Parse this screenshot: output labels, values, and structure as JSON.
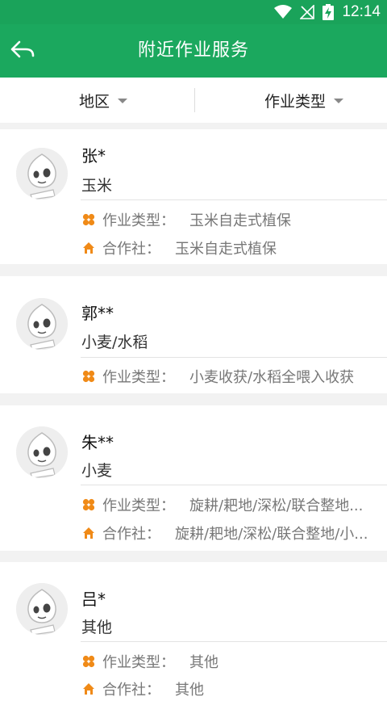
{
  "status": {
    "time": "12:14"
  },
  "appbar": {
    "title": "附近作业服务"
  },
  "filters": {
    "region": "地区",
    "type": "作业类型"
  },
  "labels": {
    "work_type": "作业类型：",
    "coop": "合作社："
  },
  "colors": {
    "brand": "#1ba85e",
    "accent_orange": "#f08a17"
  },
  "items": [
    {
      "name": "张*",
      "crop": "玉米",
      "work_type": "玉米自走式植保",
      "coop": "玉米自走式植保"
    },
    {
      "name": "郭**",
      "crop": "小麦/水稻",
      "work_type": "小麦收获/水稻全喂入收获"
    },
    {
      "name": "朱**",
      "crop": "小麦",
      "work_type": "旋耕/耙地/深松/联合整地...",
      "coop": "旋耕/耙地/深松/联合整地/小..."
    },
    {
      "name": "吕*",
      "crop": "其他",
      "work_type": "其他",
      "coop": "其他"
    }
  ]
}
